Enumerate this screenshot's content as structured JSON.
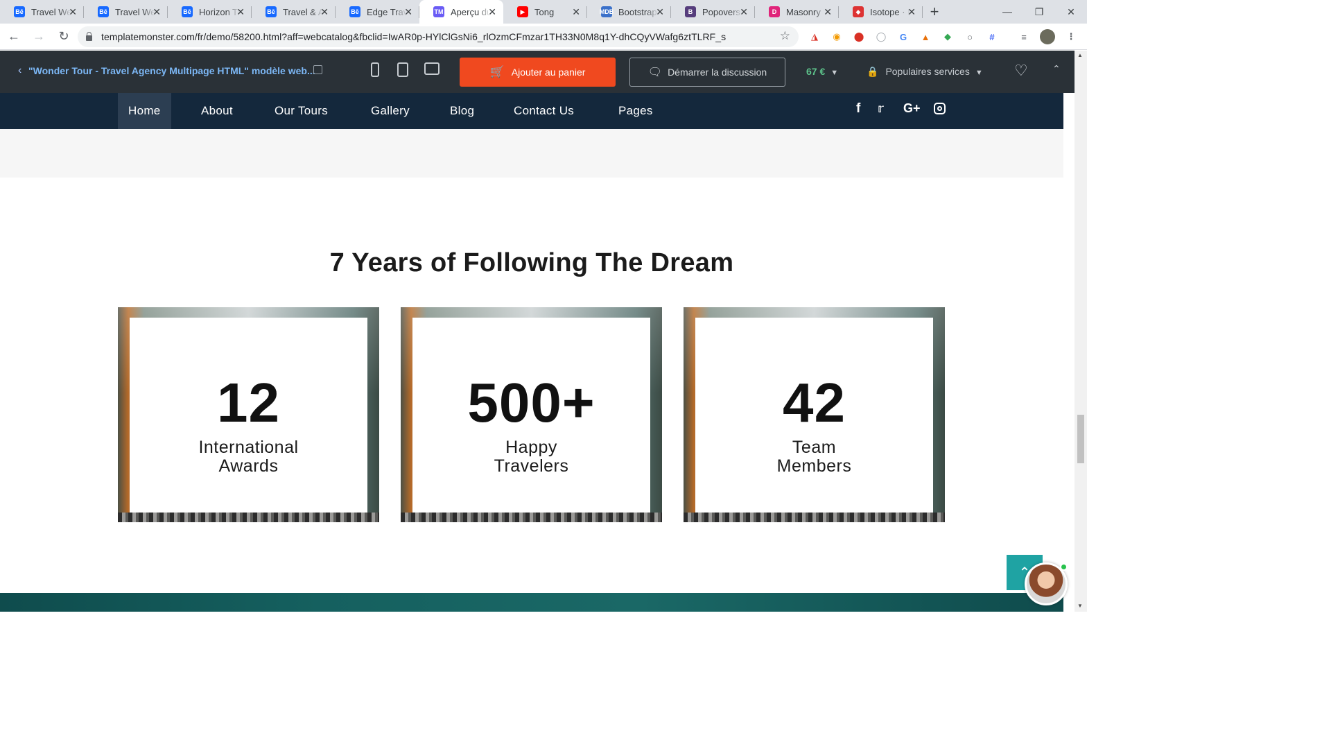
{
  "browser": {
    "tabs": [
      {
        "title": "Travel Web",
        "favicon": "Bē",
        "color": "#1769ff"
      },
      {
        "title": "Travel Web",
        "favicon": "Bē",
        "color": "#1769ff"
      },
      {
        "title": "Horizon Tr",
        "favicon": "Bē",
        "color": "#1769ff"
      },
      {
        "title": "Travel & A",
        "favicon": "Bē",
        "color": "#1769ff"
      },
      {
        "title": "Edge Trave",
        "favicon": "Bē",
        "color": "#1769ff"
      },
      {
        "title": "Aperçu du",
        "favicon": "TM",
        "color": "#6a5cf5",
        "active": true
      },
      {
        "title": "Tong",
        "favicon": "▶",
        "color": "#ff0000"
      },
      {
        "title": "Bootstrap",
        "favicon": "MDB",
        "color": "#3b71ca"
      },
      {
        "title": "Popovers",
        "favicon": "B",
        "color": "#563d7c"
      },
      {
        "title": "Masonry",
        "favicon": "D",
        "color": "#e0247a"
      },
      {
        "title": "Isotope · E",
        "favicon": "◆",
        "color": "#d33"
      }
    ],
    "url": "templatemonster.com/fr/demo/58200.html?aff=webcatalog&fbclid=IwAR0p-HYlClGsNi6_rlOzmCFmzar1TH33N0M8q1Y-dhCQyVWafg6ztTLRF_s"
  },
  "demobar": {
    "title": "\"Wonder Tour - Travel Agency Multipage HTML\" modèle web...",
    "cart_label": "Ajouter au panier",
    "chat_label": "Démarrer la discussion",
    "price": "67 €",
    "services_label": "Populaires services"
  },
  "nav": {
    "items": [
      "Home",
      "About",
      "Our Tours",
      "Gallery",
      "Blog",
      "Contact Us",
      "Pages"
    ],
    "social": [
      "f",
      "twitter",
      "G+",
      "instagram"
    ]
  },
  "section": {
    "heading": "7 Years of Following The Dream",
    "stats": [
      {
        "value": "12",
        "label_line1": "International",
        "label_line2": "Awards"
      },
      {
        "value": "500+",
        "label_line1": "Happy",
        "label_line2": "Travelers"
      },
      {
        "value": "42",
        "label_line1": "Team",
        "label_line2": "Members"
      }
    ]
  },
  "colors": {
    "cart": "#f0491f",
    "nav_bg": "#14283c",
    "demobar_bg": "#2a3137",
    "to_top": "#1fa3a3"
  }
}
